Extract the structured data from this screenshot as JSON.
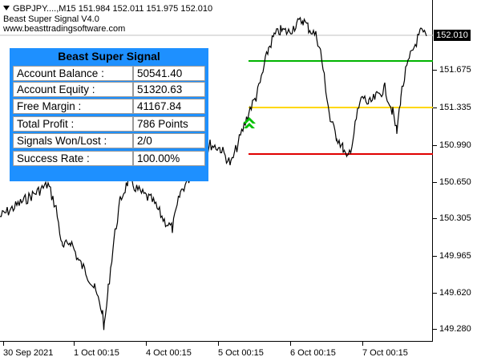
{
  "header": {
    "symbol_line": "GBPJPY....,M15  151.984 152.011 151.975 152.010",
    "indicator_name": "Beast Super Signal V4.0",
    "website": "www.beasttradingsoftware.com"
  },
  "price_axis": {
    "labels": [
      "151.675",
      "151.335",
      "150.990",
      "150.650",
      "150.305",
      "149.965",
      "149.620",
      "149.280"
    ],
    "current_price": "152.010"
  },
  "time_axis": {
    "labels": [
      "30 Sep 2021",
      "1 Oct 00:15",
      "4 Oct 00:15",
      "5 Oct 00:15",
      "6 Oct 00:15",
      "7 Oct 00:15"
    ]
  },
  "levels": {
    "take_profit_color": "#00b400",
    "entry_color": "#ffd700",
    "stop_loss_color": "#e00000"
  },
  "signal": {
    "icon": "buy-arrow-icon",
    "color": "#00c000"
  },
  "panel": {
    "title": "Beast Super Signal",
    "rows": [
      {
        "label": "Account Balance :",
        "value": "50541.40"
      },
      {
        "label": "Account Equity :",
        "value": "51320.63"
      },
      {
        "label": "Free Margin :",
        "value": "41167.84"
      },
      {
        "label": "Total Profit :",
        "value": "786 Points"
      },
      {
        "label": "Signals Won/Lost :",
        "value": "2/0"
      },
      {
        "label": "Success Rate :",
        "value": "100.00%"
      }
    ]
  }
}
